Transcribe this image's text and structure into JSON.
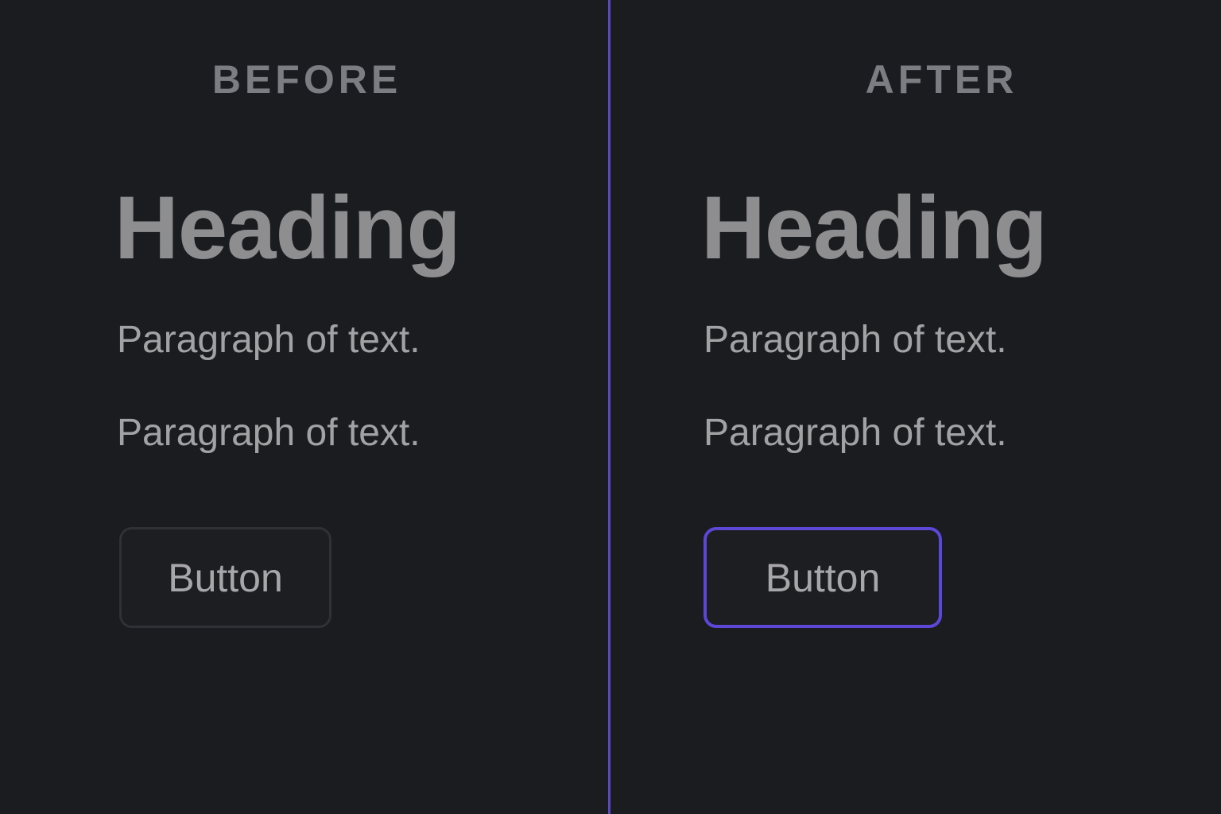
{
  "colors": {
    "background": "#1b1c20",
    "divider": "#5a48c8",
    "focus_outline": "#5b48d6",
    "default_border": "#303136",
    "text_muted": "#8e8e90"
  },
  "before": {
    "label": "BEFORE",
    "heading": "Heading",
    "paragraphs": [
      "Paragraph of text.",
      "Paragraph of text."
    ],
    "button_label": "Button"
  },
  "after": {
    "label": "AFTER",
    "heading": "Heading",
    "paragraphs": [
      "Paragraph of text.",
      "Paragraph of text."
    ],
    "button_label": "Button"
  }
}
